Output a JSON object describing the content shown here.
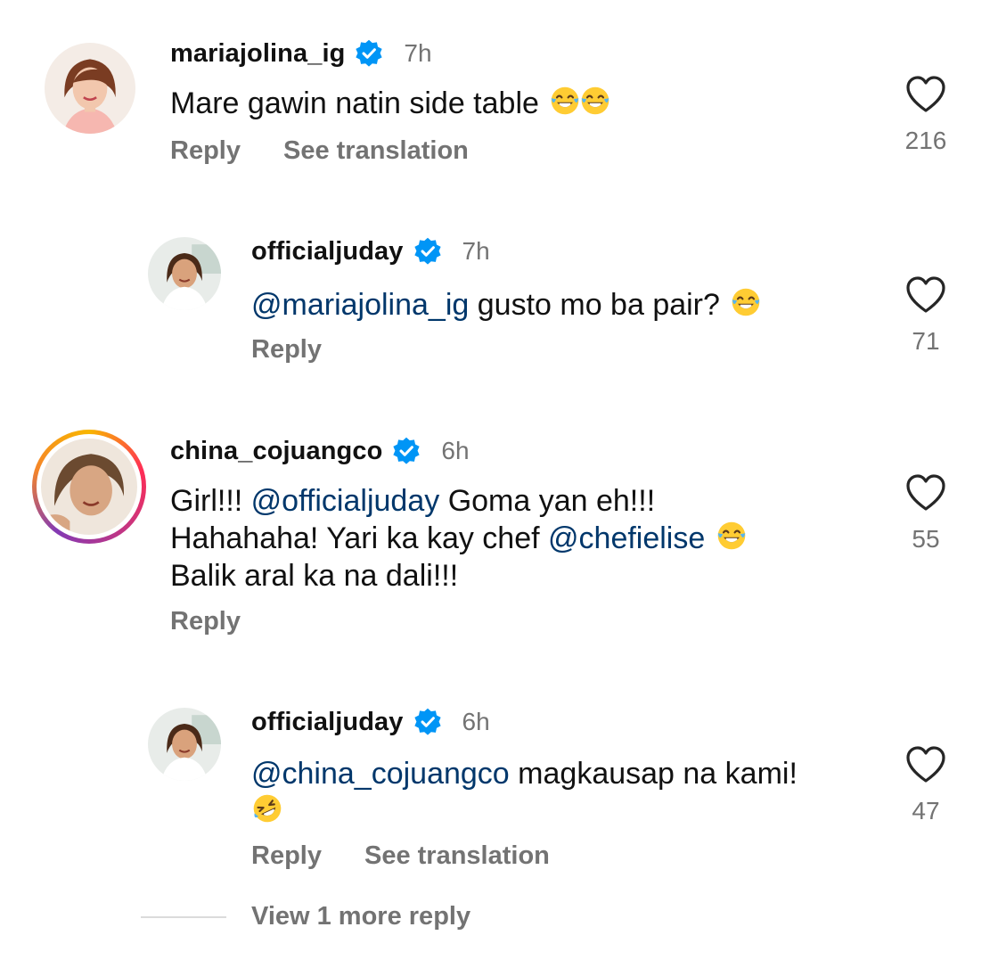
{
  "comments": [
    {
      "username": "mariajolina_ig",
      "time": "7h",
      "text_parts": [
        "Mare gawin natin side table"
      ],
      "emojis": [
        "laughing-tears-emoji",
        "laughing-tears-emoji"
      ],
      "reply_label": "Reply",
      "translate_label": "See translation",
      "likes": "216"
    },
    {
      "username": "officialjuday",
      "time": "7h",
      "mention": "@mariajolina_ig",
      "text_after": "gusto mo ba pair?",
      "emojis": [
        "laughing-tears-emoji"
      ],
      "reply_label": "Reply",
      "likes": "71"
    },
    {
      "username": "china_cojuangco",
      "time": "6h",
      "line1_before": "Girl!!!",
      "line1_mention": "@officialjuday",
      "line1_after": "Goma yan eh!!!",
      "line2_before": "Hahahaha! Yari ka kay chef",
      "line2_mention": "@chefielise",
      "line3": "Balik aral ka na dali!!!",
      "emojis": [
        "laughing-tears-emoji"
      ],
      "reply_label": "Reply",
      "likes": "55"
    },
    {
      "username": "officialjuday",
      "time": "6h",
      "mention": "@china_cojuangco",
      "text_after": "magkausap na kami!",
      "emojis": [
        "rolling-laughing-emoji"
      ],
      "reply_label": "Reply",
      "translate_label": "See translation",
      "likes": "47"
    }
  ],
  "view_more_replies": "View 1 more reply",
  "colors": {
    "mention": "#00376b",
    "verified": "#0095f6",
    "muted": "#737373",
    "story_ring": "#c13584"
  }
}
